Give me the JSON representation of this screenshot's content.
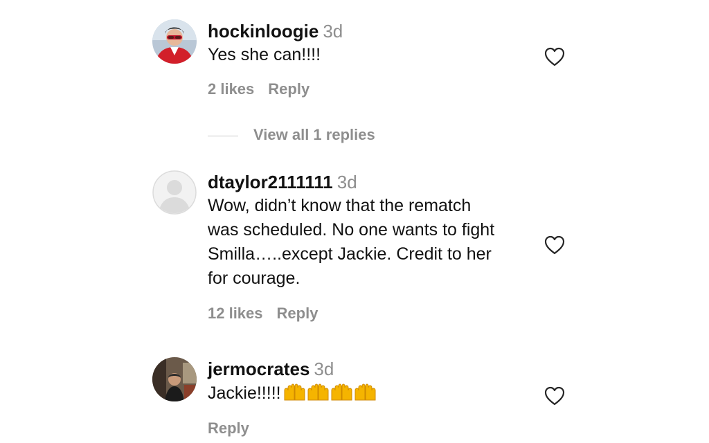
{
  "comments": [
    {
      "username": "hockinloogie",
      "time": "3d",
      "text": "Yes she can!!!!",
      "likes": "2 likes",
      "reply": "Reply",
      "avatar_icon": "user-photo-red-jacket"
    },
    {
      "username": "dtaylor2111111",
      "time": "3d",
      "text_lines": [
        "Wow, didn’t know that the rematch",
        "was scheduled. No one wants to fight",
        "Smilla…..except Jackie. Credit to her",
        "for courage."
      ],
      "likes": "12 likes",
      "reply": "Reply",
      "avatar_icon": "default-avatar-icon"
    },
    {
      "username": "jermocrates",
      "time": "3d",
      "text": "Jackie!!!!!",
      "emoji": "raising-hands-emoji x4",
      "reply": "Reply",
      "avatar_icon": "user-photo-dark"
    }
  ],
  "view_replies": {
    "label": "View all 1 replies"
  },
  "colors": {
    "text": "#111111",
    "muted": "#8e8e8e",
    "divider": "#c7c7c7",
    "emoji": "#f5b400"
  }
}
